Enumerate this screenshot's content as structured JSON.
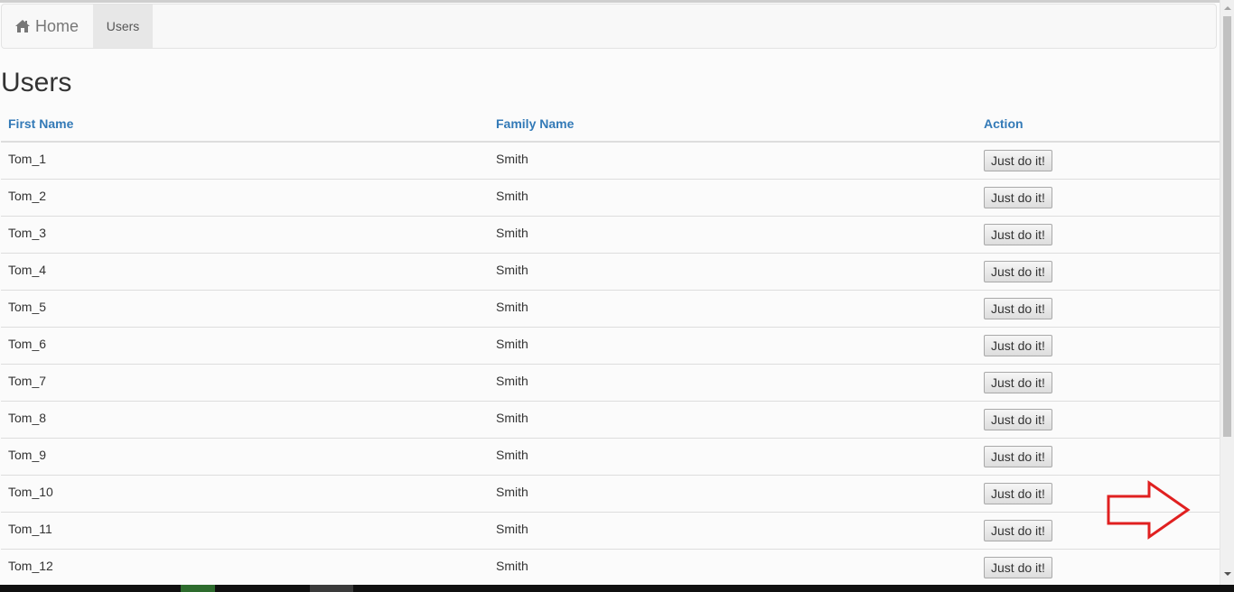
{
  "navbar": {
    "brand_label": "Home",
    "brand_icon": "home-icon",
    "active_item_label": "Users"
  },
  "page": {
    "title": "Users"
  },
  "table": {
    "headers": {
      "first_name": "First Name",
      "family_name": "Family Name",
      "action": "Action"
    },
    "rows": [
      {
        "first_name": "Tom_1",
        "family_name": "Smith",
        "action_label": "Just do it!"
      },
      {
        "first_name": "Tom_2",
        "family_name": "Smith",
        "action_label": "Just do it!"
      },
      {
        "first_name": "Tom_3",
        "family_name": "Smith",
        "action_label": "Just do it!"
      },
      {
        "first_name": "Tom_4",
        "family_name": "Smith",
        "action_label": "Just do it!"
      },
      {
        "first_name": "Tom_5",
        "family_name": "Smith",
        "action_label": "Just do it!"
      },
      {
        "first_name": "Tom_6",
        "family_name": "Smith",
        "action_label": "Just do it!"
      },
      {
        "first_name": "Tom_7",
        "family_name": "Smith",
        "action_label": "Just do it!"
      },
      {
        "first_name": "Tom_8",
        "family_name": "Smith",
        "action_label": "Just do it!"
      },
      {
        "first_name": "Tom_9",
        "family_name": "Smith",
        "action_label": "Just do it!"
      },
      {
        "first_name": "Tom_10",
        "family_name": "Smith",
        "action_label": "Just do it!"
      },
      {
        "first_name": "Tom_11",
        "family_name": "Smith",
        "action_label": "Just do it!"
      },
      {
        "first_name": "Tom_12",
        "family_name": "Smith",
        "action_label": "Just do it!"
      }
    ]
  },
  "colors": {
    "header_link": "#337ab7",
    "annotation_arrow": "#e02020"
  }
}
